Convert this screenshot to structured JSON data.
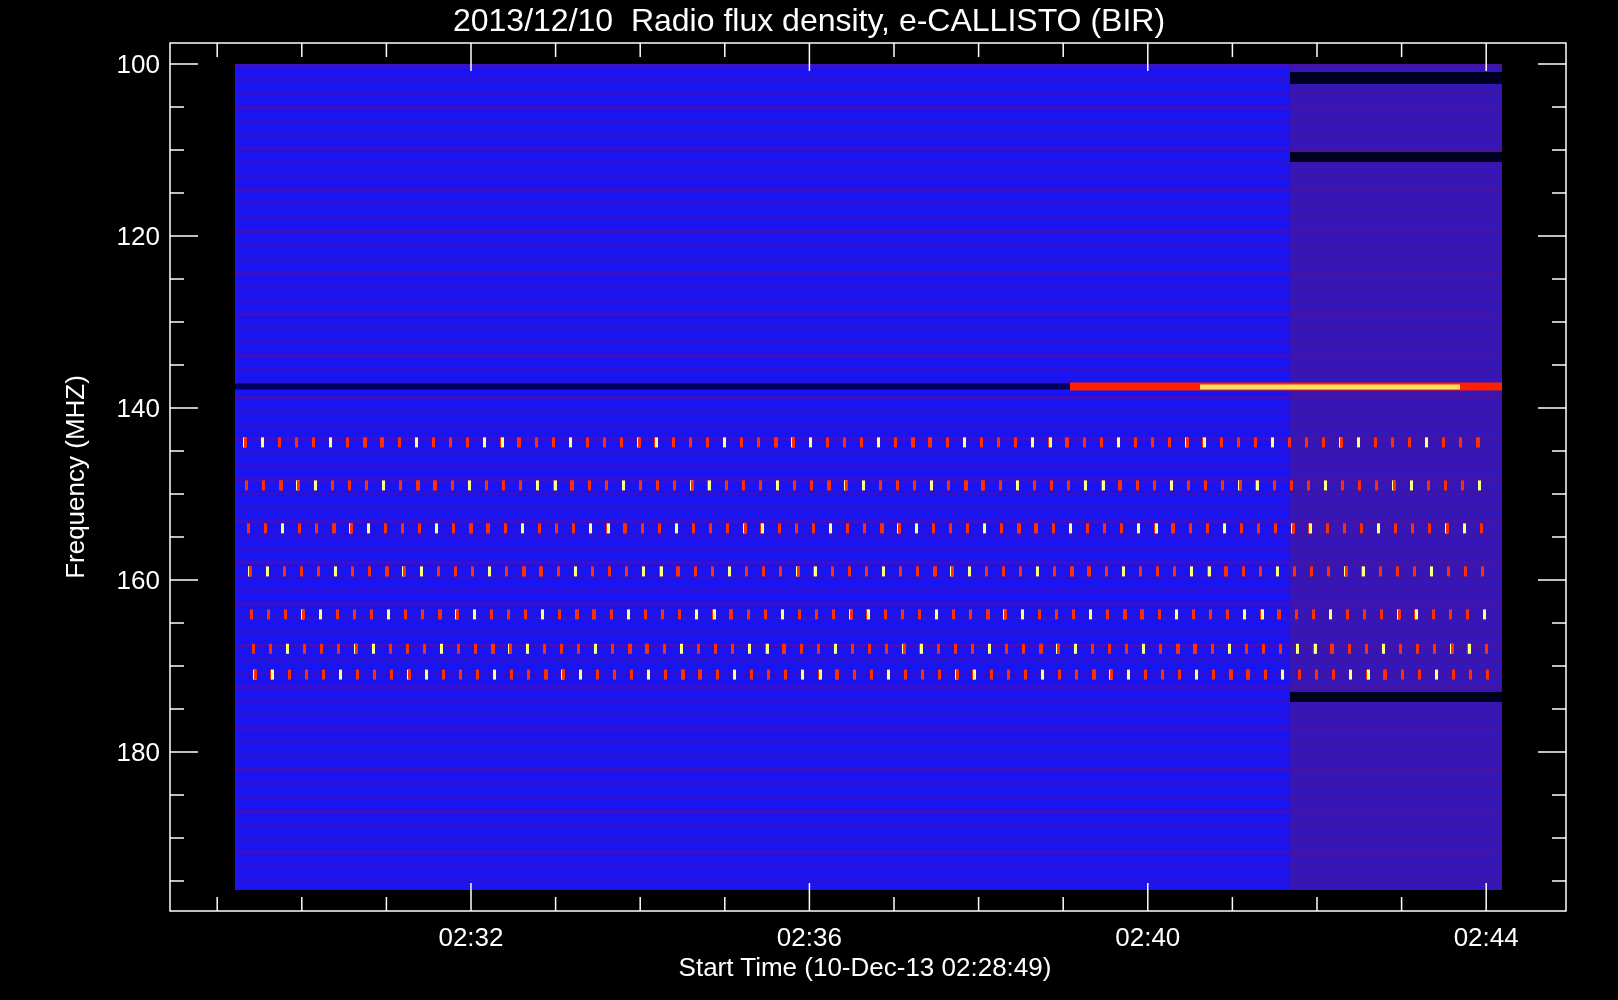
{
  "title": "2013/12/10  Radio flux density, e-CALLISTO (BIR)",
  "y_axis": {
    "label": "Frequency (MHZ)",
    "ticks": [
      "100",
      "120",
      "140",
      "160",
      "180"
    ]
  },
  "x_axis": {
    "label": "Start Time (10-Dec-13 02:28:49)",
    "ticks": [
      "02:32",
      "02:36",
      "02:40",
      "02:44"
    ]
  }
}
